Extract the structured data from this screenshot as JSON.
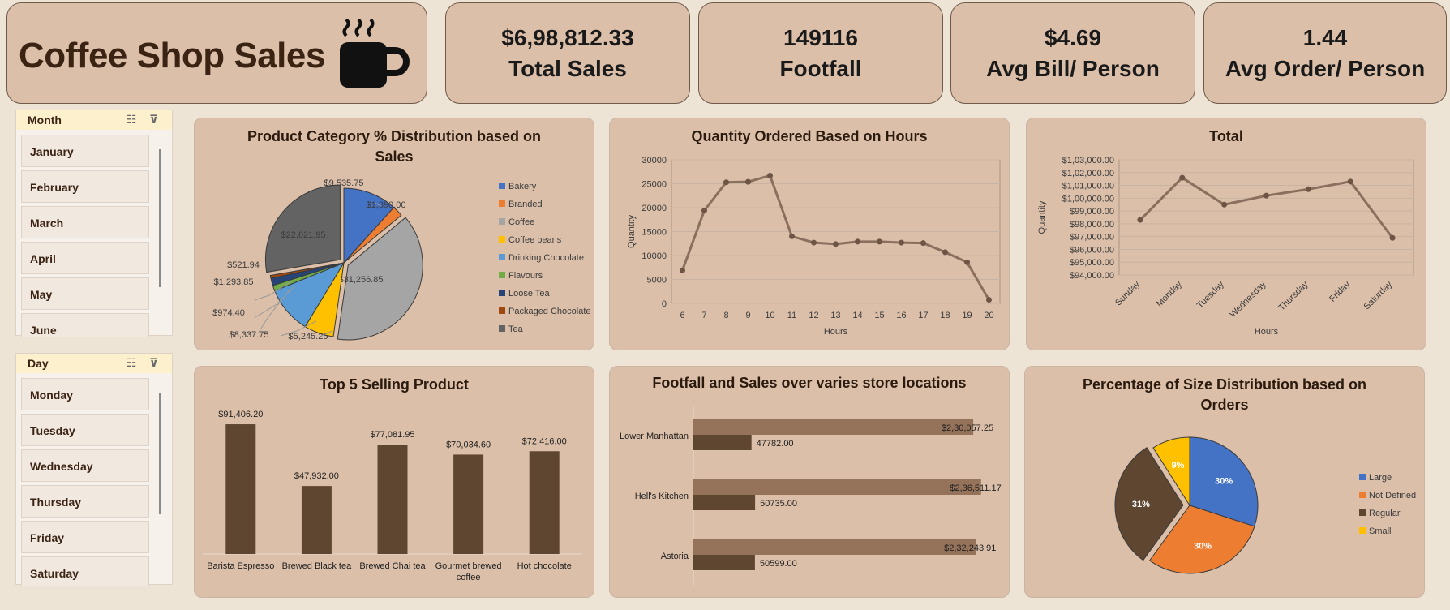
{
  "title": {
    "text": "Coffee Shop Sales",
    "icon": "coffee-cup-icon"
  },
  "kpis": [
    {
      "value": "$6,98,812.33",
      "label": "Total Sales"
    },
    {
      "value": "149116",
      "label": "Footfall"
    },
    {
      "value": "$4.69",
      "label": "Avg Bill/ Person"
    },
    {
      "value": "1.44",
      "label": "Avg Order/ Person"
    }
  ],
  "slicers": {
    "month": {
      "title": "Month",
      "items": [
        "January",
        "February",
        "March",
        "April",
        "May",
        "June"
      ]
    },
    "day": {
      "title": "Day",
      "items": [
        "Monday",
        "Tuesday",
        "Wednesday",
        "Thursday",
        "Friday",
        "Saturday"
      ]
    }
  },
  "colors": {
    "brown_dark": "#5f4631",
    "brown_mid": "#95725a",
    "panel_bg": "#dbbfa9"
  },
  "chart_data": [
    {
      "type": "pie",
      "title": "Product Category % Distribution based on Sales",
      "categories": [
        "Bakery",
        "Branded",
        "Coffee",
        "Coffee beans",
        "Drinking Chocolate",
        "Flavours",
        "Loose Tea",
        "Packaged Chocolate",
        "Tea"
      ],
      "values": [
        9535.75,
        1890.0,
        31256.85,
        5245.25,
        8337.75,
        974.4,
        1293.85,
        521.94,
        22621.95
      ],
      "labels": [
        "$9,535.75",
        "$1,890.00",
        "$31,256.85",
        "$5,245.25",
        "$8,337.75",
        "$974.40",
        "$1,293.85",
        "$521.94",
        "$22,621.95"
      ],
      "colors": [
        "#4472c4",
        "#ed7d31",
        "#a5a5a5",
        "#ffc000",
        "#5b9bd5",
        "#70ad47",
        "#264478",
        "#9e480e",
        "#636363"
      ],
      "legend": "right"
    },
    {
      "type": "line",
      "title": "Quantity Ordered Based on Hours",
      "xlabel": "Hours",
      "ylabel": "Quantity",
      "x": [
        "6",
        "7",
        "8",
        "9",
        "10",
        "11",
        "12",
        "13",
        "14",
        "15",
        "16",
        "17",
        "18",
        "19",
        "20"
      ],
      "values": [
        6900,
        19400,
        25300,
        25400,
        26700,
        14000,
        12700,
        12400,
        12900,
        12900,
        12700,
        12600,
        10700,
        8600,
        750
      ],
      "ylim": [
        0,
        30000
      ],
      "yticks": [
        "0",
        "5000",
        "10000",
        "15000",
        "20000",
        "25000",
        "30000"
      ],
      "grid": true
    },
    {
      "type": "line",
      "title": "Total",
      "xlabel": "Hours",
      "ylabel": "Quantity",
      "x": [
        "Sunday",
        "Monday",
        "Tuesday",
        "Wednesday",
        "Thursday",
        "Friday",
        "Saturday"
      ],
      "values": [
        98300,
        101600,
        99500,
        100200,
        100700,
        101300,
        96900
      ],
      "ylim": [
        94000,
        103000
      ],
      "yticks": [
        "$94,000.00",
        "$95,000.00",
        "$96,000.00",
        "$97,000.00",
        "$98,000.00",
        "$99,000.00",
        "$1,00,000.00",
        "$1,01,000.00",
        "$1,02,000.00",
        "$1,03,000.00"
      ],
      "grid": true
    },
    {
      "type": "bar",
      "title": "Top 5 Selling Product",
      "categories": [
        "Barista Espresso",
        "Brewed Black tea",
        "Brewed Chai tea",
        "Gourmet brewed coffee",
        "Hot chocolate"
      ],
      "values": [
        91406.2,
        47932.0,
        77081.95,
        70034.6,
        72416.0
      ],
      "labels": [
        "$91,406.20",
        "$47,932.00",
        "$77,081.95",
        "$70,034.60",
        "$72,416.00"
      ],
      "ylim": [
        0,
        100000
      ]
    },
    {
      "type": "bar",
      "title": "Footfall and Sales over varies store locations",
      "categories": [
        "Lower Manhattan",
        "Hell's Kitchen",
        "Astoria"
      ],
      "series": [
        {
          "values": [
            230057.25,
            236511.17,
            232243.91
          ],
          "labels": [
            "$2,30,057.25",
            "$2,36,511.17",
            "$2,32,243.91"
          ]
        },
        {
          "values": [
            47782,
            50735,
            50599
          ],
          "labels": [
            "47782.00",
            "50735.00",
            "50599.00"
          ]
        }
      ],
      "orientation": "horizontal"
    },
    {
      "type": "pie",
      "title": "Percentage of Size Distribution based on Orders",
      "categories": [
        "Large",
        "Not Defined",
        "Regular",
        "Small"
      ],
      "values": [
        30,
        30,
        31,
        9
      ],
      "labels": [
        "30%",
        "30%",
        "31%",
        "9%"
      ],
      "colors": [
        "#4472c4",
        "#ed7d31",
        "#5f4631",
        "#ffc000"
      ],
      "legend": "right"
    }
  ]
}
